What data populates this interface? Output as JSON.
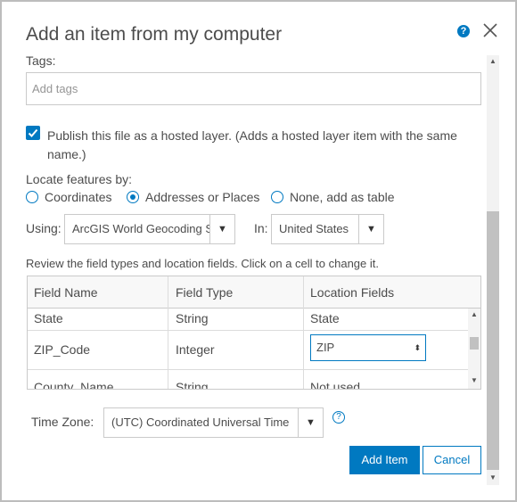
{
  "dialog": {
    "title": "Add an item from my computer",
    "help_icon": "question-circle-icon",
    "close_icon": "close-icon"
  },
  "tags": {
    "label": "Tags:",
    "placeholder": "Add tags"
  },
  "publish": {
    "checked": true,
    "text": "Publish this file as a hosted layer. (Adds a hosted layer item with the same name.)"
  },
  "locate": {
    "label": "Locate features by:",
    "options": [
      {
        "label": "Coordinates",
        "checked": false
      },
      {
        "label": "Addresses or Places",
        "checked": true
      },
      {
        "label": "None, add as table",
        "checked": false
      }
    ]
  },
  "using": {
    "label": "Using:",
    "value": "ArcGIS World Geocoding S"
  },
  "in": {
    "label": "In:",
    "value": "United States"
  },
  "review_text": "Review the field types and location fields. Click on a cell to change it.",
  "table": {
    "headers": [
      "Field Name",
      "Field Type",
      "Location Fields"
    ],
    "rows": [
      {
        "name": "State",
        "type": "String",
        "location": "State"
      },
      {
        "name": "ZIP_Code",
        "type": "Integer",
        "location": "ZIP"
      },
      {
        "name": "County_Name",
        "type": "String",
        "location": "Not used"
      }
    ]
  },
  "timezone": {
    "label": "Time Zone:",
    "value": "(UTC) Coordinated Universal Time"
  },
  "buttons": {
    "add": "Add Item",
    "cancel": "Cancel"
  },
  "colors": {
    "accent": "#0079c1",
    "text": "#4c4c4c",
    "border": "#cacaca"
  }
}
